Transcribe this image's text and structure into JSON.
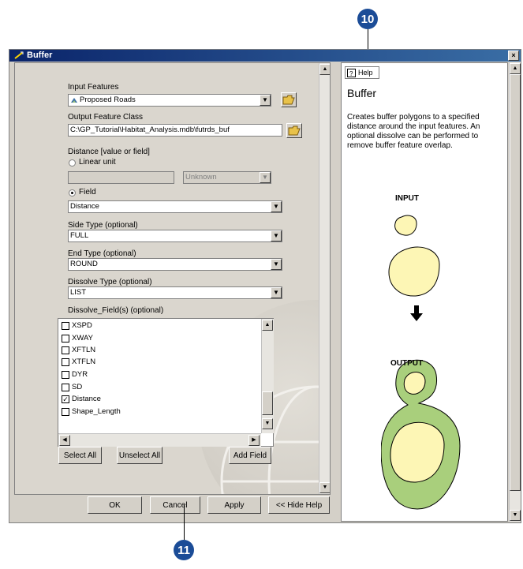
{
  "callouts": {
    "top": "10",
    "bottom": "11"
  },
  "window": {
    "title": "Buffer",
    "close_glyph": "×"
  },
  "form": {
    "input_features_label": "Input Features",
    "input_features_value": "Proposed Roads",
    "output_class_label": "Output Feature Class",
    "output_class_value": "C:\\GP_Tutorial\\Habitat_Analysis.mdb\\futrds_buf",
    "distance_label": "Distance [value or field]",
    "linear_unit_label": "Linear unit",
    "linear_unit_value": "",
    "unit_value": "Unknown",
    "field_label": "Field",
    "field_value": "Distance",
    "side_type_label": "Side Type (optional)",
    "side_type_value": "FULL",
    "end_type_label": "End Type (optional)",
    "end_type_value": "ROUND",
    "dissolve_type_label": "Dissolve Type (optional)",
    "dissolve_type_value": "LIST",
    "dissolve_fields_label": "Dissolve_Field(s) (optional)",
    "fields": [
      {
        "name": "XSPD",
        "checked": false
      },
      {
        "name": "XWAY",
        "checked": false
      },
      {
        "name": "XFTLN",
        "checked": false
      },
      {
        "name": "XTFLN",
        "checked": false
      },
      {
        "name": "DYR",
        "checked": false
      },
      {
        "name": "SD",
        "checked": false
      },
      {
        "name": "Distance",
        "checked": true
      },
      {
        "name": "Shape_Length",
        "checked": false
      }
    ],
    "select_all": "Select All",
    "unselect_all": "Unselect All",
    "add_field": "Add Field"
  },
  "buttons": {
    "ok": "OK",
    "cancel": "Cancel",
    "apply": "Apply",
    "hide_help": "<< Hide Help"
  },
  "help": {
    "tab_label": "Help",
    "title": "Buffer",
    "description": "Creates buffer polygons to a specified distance around the input features. An optional dissolve can be performed to remove buffer feature overlap.",
    "input_label": "INPUT",
    "output_label": "OUTPUT"
  },
  "colors": {
    "callout": "#1b4c97",
    "feature_fill": "#fdf6b5",
    "buffer_fill": "#a9cf7c"
  }
}
